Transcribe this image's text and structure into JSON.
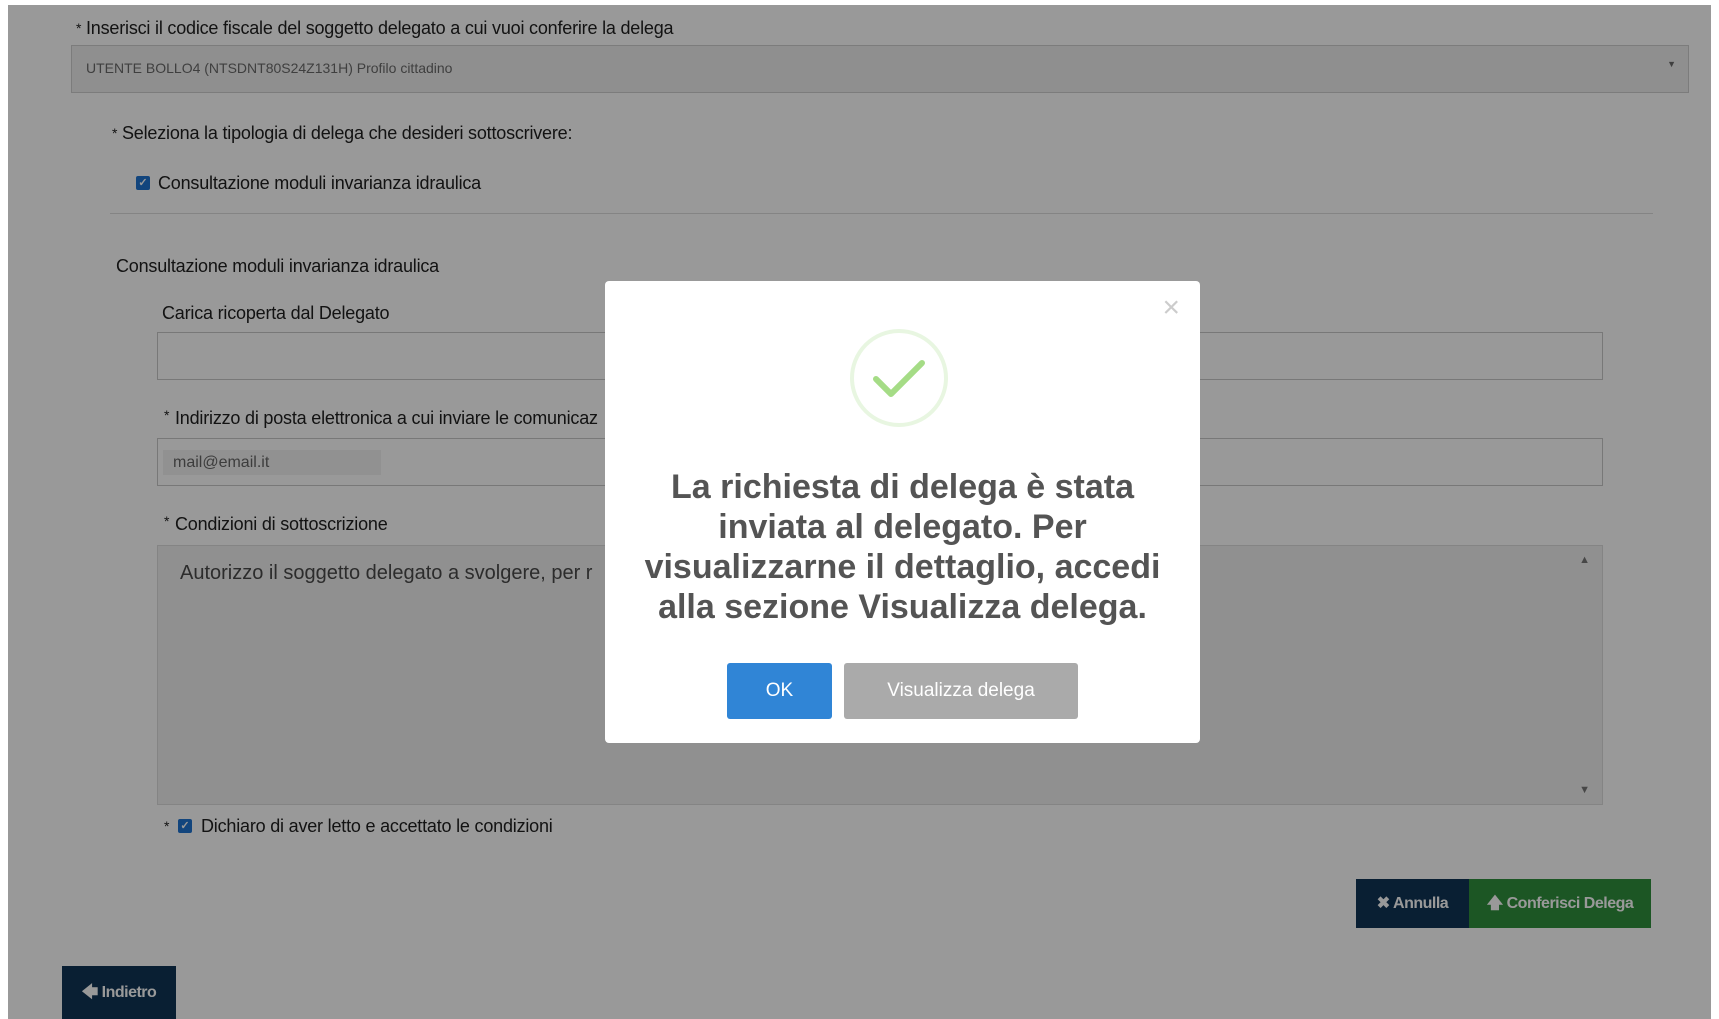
{
  "form": {
    "delegate_label": "Inserisci il codice fiscale del soggetto delegato a cui vuoi conferire la delega",
    "delegate_value": "UTENTE BOLLO4 (NTSDNT80S24Z131H) Profilo cittadino",
    "type_label": "Seleziona la tipologia di delega che desideri sottoscrivere:",
    "type_option": "Consultazione moduli invarianza idraulica",
    "type_option_checked": true,
    "section_title": "Consultazione moduli invarianza idraulica",
    "carica_label": "Carica ricoperta dal Delegato",
    "carica_value": "",
    "email_label": "Indirizzo di posta elettronica a cui inviare le comunicaz",
    "email_placeholder": "mail@email.it",
    "conditions_label": "Condizioni di sottoscrizione",
    "conditions_text": "Autorizzo il soggetto delegato a svolgere, per r",
    "accept_label": "Dichiaro di aver letto e accettato le condizioni",
    "accept_checked": true,
    "required_marker": "*"
  },
  "actions": {
    "cancel_label": "✖ Annulla",
    "confirm_label": "🡅 Conferisci Delega",
    "back_label": "🡄 Indietro"
  },
  "modal": {
    "message": "La richiesta di delega è stata inviata al delegato. Per visualizzarne il dettaglio, accedi alla sezione Visualizza delega.",
    "ok_label": "OK",
    "view_label": "Visualizza delega",
    "close_glyph": "×",
    "success_color": "#a5dc86"
  },
  "colors": {
    "primary_dark": "#103456",
    "success_green": "#2f8f3d",
    "modal_ok": "#3085d6",
    "modal_secondary": "#aaaaaa"
  }
}
